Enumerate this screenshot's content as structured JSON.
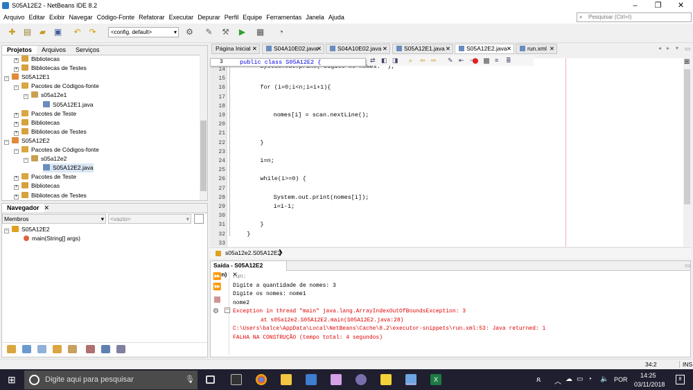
{
  "window": {
    "title": "S05A12E2 - NetBeans IDE 8.2"
  },
  "menu": [
    "Arquivo",
    "Editar",
    "Exibir",
    "Navegar",
    "Código-Fonte",
    "Refatorar",
    "Executar",
    "Depurar",
    "Perfil",
    "Equipe",
    "Ferramentas",
    "Janela",
    "Ajuda"
  ],
  "search": {
    "placeholder": "Pesquisar (Ctrl+I)"
  },
  "toolbar": {
    "config": "<config. default>"
  },
  "projects": {
    "tabs": [
      "Projetos",
      "Arquivos",
      "Serviços"
    ],
    "tree": [
      "Bibliotecas",
      "Bibliotecas de Testes",
      "S05A12E1",
      "Pacotes de Códigos-fonte",
      "s05a12e1",
      "S05A12E1.java",
      "Pacotes de Teste",
      "Bibliotecas",
      "Bibliotecas de Testes",
      "S05A12E2",
      "Pacotes de Códigos-fonte",
      "s05a12e2",
      "S05A12E2.java",
      "Pacotes de Teste",
      "Bibliotecas",
      "Bibliotecas de Testes"
    ]
  },
  "navigator": {
    "title": "Navegador",
    "members": "Membros",
    "empty": "<vazio>",
    "root": "S05A12E2",
    "method": "main(String[] args)"
  },
  "editor": {
    "tabs": [
      "Página Inicial",
      "S04A10E02.java",
      "S04A10E02.java",
      "S05A12E1.java",
      "S05A12E2.java",
      "run.xml"
    ],
    "sticky_line": "3",
    "sticky_code": "public class S05A12E2 {",
    "line_numbers": [
      "14",
      "15",
      "16",
      "17",
      "18",
      "19",
      "20",
      "21",
      "22",
      "23",
      "24",
      "25",
      "26",
      "27",
      "28",
      "29",
      "30",
      "31",
      "32",
      "33"
    ],
    "lines": [
      "System.out.print(\"Digite os nomes: \");",
      "",
      "for (i=0;i<n;i=i+1){",
      "",
      "",
      "nomes[i] = scan.nextLine();",
      "",
      "",
      "}",
      "",
      "i=n;",
      "",
      "while(i>=0) {",
      "",
      "System.out.print(nomes[i]);",
      "i=i-1;",
      "",
      "}",
      "}",
      ""
    ],
    "breadcrumb": "s05a12e2.S05A12E2"
  },
  "output": {
    "title": "Saída - S05A12E2 (run)",
    "lines": [
      "run:",
      "Digite a quantidade de nomes: 3",
      "Digite os nomes: nome1",
      "nome2",
      "Exception in thread \"main\" java.lang.ArrayIndexOutOfBoundsException: 3",
      "\tat s05a12e2.S05A12E2.main(S05A12E2.java:28)",
      "C:\\Users\\balce\\AppData\\Local\\NetBeans\\Cache\\8.2\\executor-snippets\\run.xml:53: Java returned: 1",
      "FALHA NA CONSTRUÇÃO (tempo total: 4 segundos)"
    ]
  },
  "status": {
    "position": "34:2",
    "mode": "INS"
  },
  "taskbar": {
    "search": "Digite aqui para pesquisar",
    "language": "POR",
    "time": "14:25",
    "date": "03/11/2018",
    "notif": "8"
  },
  "colors": {
    "keyword": "#0000e6",
    "error": "#e00000",
    "link": "#0000cc"
  }
}
